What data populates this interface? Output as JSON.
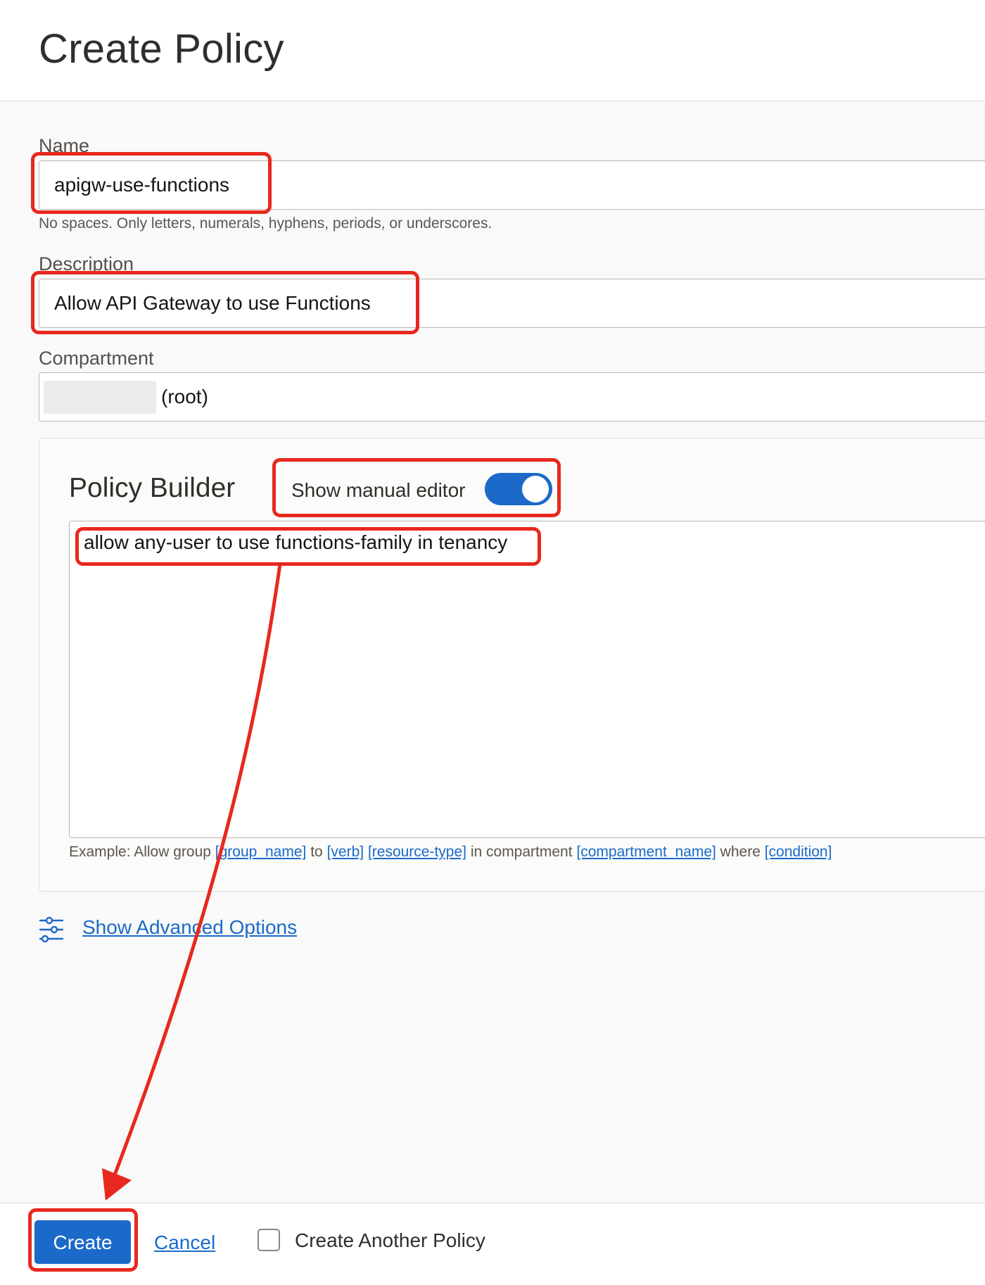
{
  "page": {
    "title": "Create Policy"
  },
  "form": {
    "name": {
      "label": "Name",
      "value": "apigw-use-functions",
      "hint": "No spaces. Only letters, numerals, hyphens, periods, or underscores."
    },
    "description": {
      "label": "Description",
      "value": "Allow API Gateway to use Functions"
    },
    "compartment": {
      "label": "Compartment",
      "value": "(root)"
    }
  },
  "policy_builder": {
    "title": "Policy Builder",
    "manual_editor_label": "Show manual editor",
    "manual_editor_enabled": true,
    "statement": "allow any-user to use functions-family in tenancy",
    "example": {
      "prefix": "Example: Allow group ",
      "group_name": "[group_name]",
      "to": " to ",
      "verb": "[verb]",
      "resource_type": "[resource-type]",
      "in_compartment": " in compartment ",
      "compartment_name": "[compartment_name]",
      "where": " where ",
      "condition": "[condition]"
    }
  },
  "advanced_options": {
    "icon": "sliders-icon",
    "label": "Show Advanced Options"
  },
  "footer": {
    "create_label": "Create",
    "cancel_label": "Cancel",
    "create_another_label": "Create Another Policy",
    "create_another_checked": false
  },
  "colors": {
    "accent": "#1b6ac9",
    "annotation": "#e8281e",
    "text": "#312d2a"
  }
}
